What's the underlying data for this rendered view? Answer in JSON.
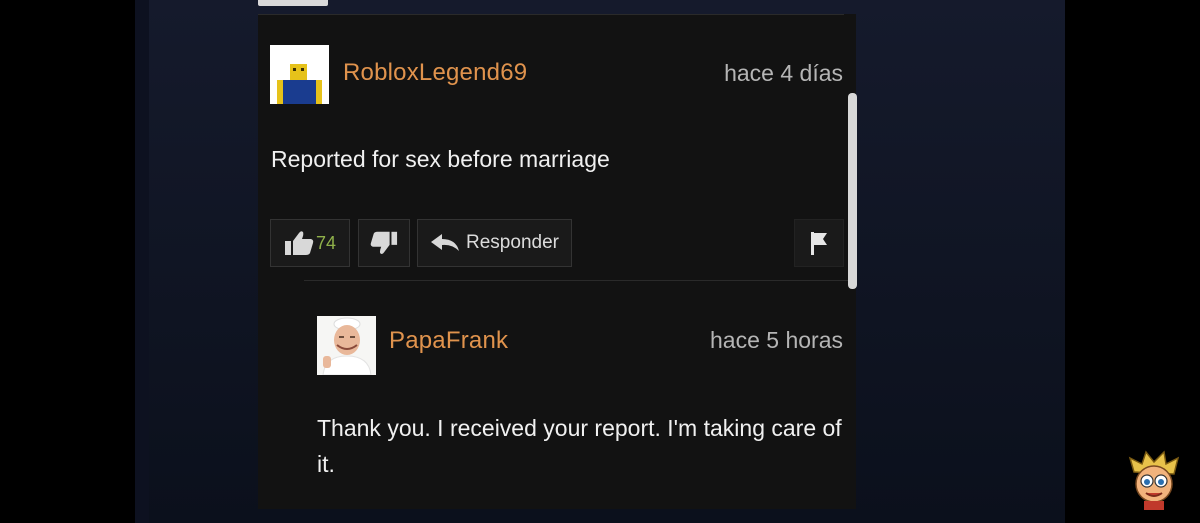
{
  "comments": [
    {
      "username": "RobloxLegend69",
      "time": "hace 4 días",
      "text": "Reported for sex before marriage",
      "likes": "74",
      "reply_label": "Responder"
    },
    {
      "username": "PapaFrank",
      "time": "hace 5 horas",
      "text": "Thank you. I received your report. I'm taking care of it."
    }
  ],
  "icons": {
    "like": "thumbs-up-icon",
    "dislike": "thumbs-down-icon",
    "reply": "reply-arrow-icon",
    "flag": "flag-icon"
  },
  "colors": {
    "username": "#e0934d",
    "like_count": "#8fb04a",
    "card_bg": "#121212"
  }
}
